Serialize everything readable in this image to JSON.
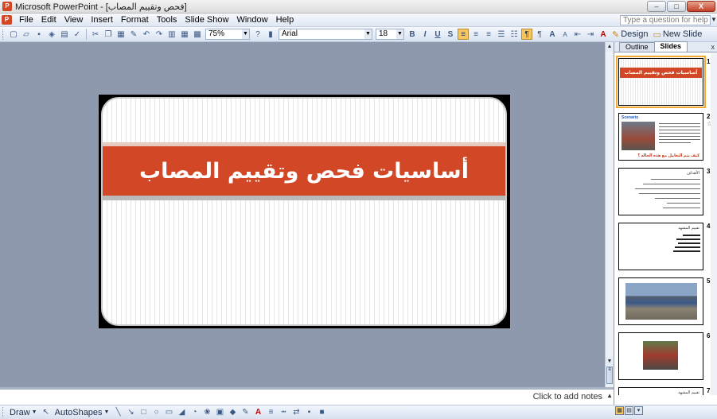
{
  "window": {
    "app_icon": "P",
    "title": "Microsoft PowerPoint - [فحص وتقييم المصاب]",
    "controls": {
      "minimize": "–",
      "maximize": "□",
      "close": "X"
    }
  },
  "menu": {
    "icon": "P",
    "items": [
      "File",
      "Edit",
      "View",
      "Insert",
      "Format",
      "Tools",
      "Slide Show",
      "Window",
      "Help"
    ],
    "help_placeholder": "Type a question for help"
  },
  "toolbar": {
    "zoom": "75%",
    "font": "Arial",
    "font_size": "18",
    "bold": "B",
    "italic": "I",
    "underline": "U",
    "shadow": "S",
    "grow_font": "A",
    "shrink_font": "A",
    "font_color": "A",
    "design_label": "Design",
    "new_slide_label": "New Slide"
  },
  "slide": {
    "title": "أساسيات فحص وتقييم المصاب",
    "accent_color": "#d24726"
  },
  "notes": {
    "placeholder": "Click to add notes"
  },
  "pane": {
    "tabs": [
      "Outline",
      "Slides"
    ],
    "active_tab": "Slides",
    "close": "x",
    "thumbnails": [
      {
        "number": "1",
        "title": "أساسيات فحص وتقييم المصاب",
        "selected": true
      },
      {
        "number": "2",
        "title": "Scenario",
        "caption": "كيف يتم التعامل مع هذه الحالة ؟",
        "animated": true
      },
      {
        "number": "3",
        "title": "الأهداف"
      },
      {
        "number": "4",
        "title": "تقييم المشهد"
      },
      {
        "number": "5",
        "title": ""
      },
      {
        "number": "6",
        "title": ""
      },
      {
        "number": "7",
        "title": "تقييم المشهد"
      }
    ]
  },
  "drawbar": {
    "draw": "Draw",
    "autoshapes": "AutoShapes"
  }
}
